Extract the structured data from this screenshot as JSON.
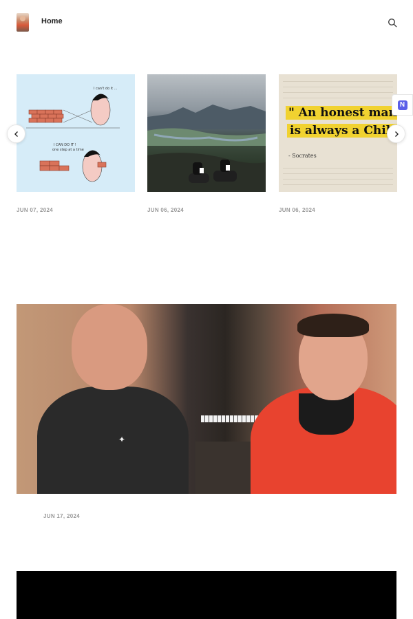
{
  "header": {
    "logo_icon": "profile-photo-logo",
    "nav_home_label": "Home",
    "search_icon": "search-icon"
  },
  "carousel": {
    "cards": [
      {
        "date": "JUN 07, 2024",
        "image": "comic-illustration-bricks"
      },
      {
        "date": "JUN 06, 2024",
        "image": "landscape-mountain-view"
      },
      {
        "date": "JUN 06, 2024",
        "image": "quote-book-page",
        "quote_line1": "\" An honest man",
        "quote_line2": "is always a Child.",
        "quote_author": "- Socrates"
      }
    ],
    "prev_icon": "chevron-left-icon",
    "next_icon": "chevron-right-icon"
  },
  "badge": {
    "icon": "notion-icon",
    "letter": "N",
    "color": "#5b5fe8"
  },
  "featured": {
    "image": "two-men-studio-photo",
    "date": "JUN 17, 2024"
  },
  "next_post": {
    "image": "black-video-thumbnail"
  }
}
